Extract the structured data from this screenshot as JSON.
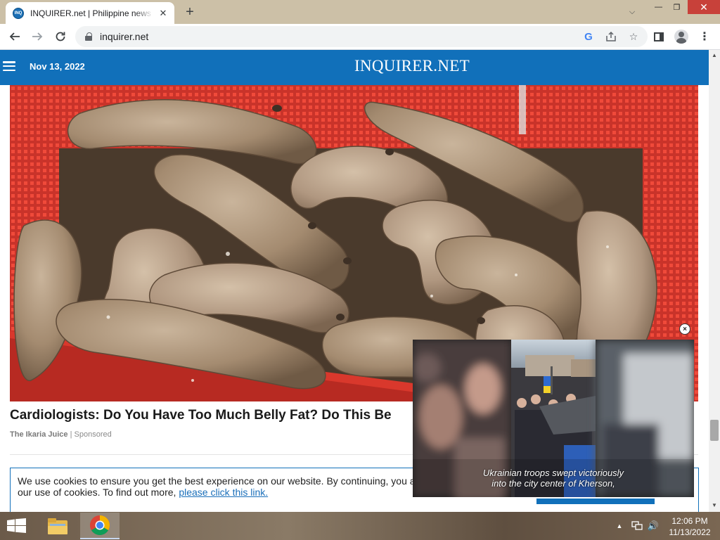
{
  "browser": {
    "tab": {
      "favicon_text": "INQ",
      "title": "INQUIRER.net | Philippine news for Filipinos"
    },
    "address": {
      "url": "inquirer.net"
    },
    "icons": {
      "back": "arrow-left-icon",
      "forward": "arrow-right-icon",
      "reload": "reload-icon",
      "google": "google-icon",
      "share": "share-icon",
      "bookmark": "star-icon",
      "side_panel": "side-panel-icon",
      "profile": "profile-icon",
      "menu": "kebab-menu-icon"
    }
  },
  "site": {
    "date": "Nov 13, 2022",
    "logo": "INQUIRER.NET",
    "brand_color": "#1170ba"
  },
  "sponsored": {
    "headline": "Cardiologists: Do You Have Too Much Belly Fat? Do This Be",
    "source": "The Ikaria Juice",
    "separator": "|",
    "label": "Sponsored"
  },
  "video": {
    "caption_line1": "Ukrainian troops swept victoriously",
    "caption_line2": "into the city center of Kherson,",
    "close_label": "×"
  },
  "cookie": {
    "text_line1": "We use cookies to ensure you get the best experience on our website. By continuing, you a",
    "text_line2": "our use of cookies. To find out more,",
    "link": "please click this link."
  },
  "taskbar": {
    "time": "12:06 PM",
    "date": "11/13/2022"
  }
}
